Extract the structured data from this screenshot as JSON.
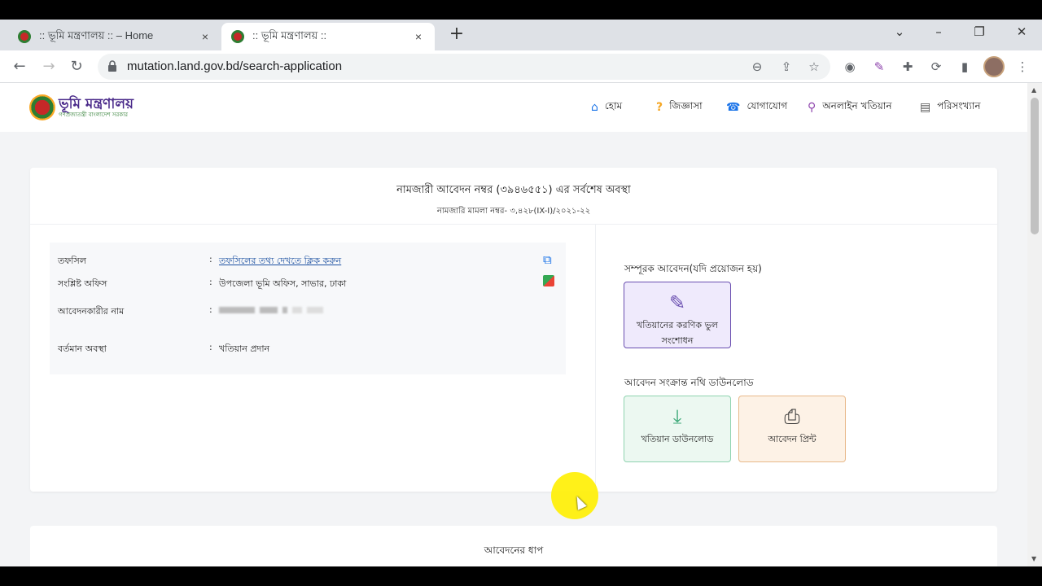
{
  "tabs": [
    {
      "title": ":: ভূমি মন্ত্রণালয় :: – Home",
      "close": "×"
    },
    {
      "title": ":: ভূমি মন্ত্রণালয় ::",
      "close": "×"
    }
  ],
  "new_tab": "+",
  "window_controls": {
    "dropdown": "⌄",
    "minimize": "–",
    "restore": "❐",
    "close": "✕"
  },
  "address_bar": {
    "url": "mutation.land.gov.bd/search-application"
  },
  "nav": {
    "back": "←",
    "forward": "→",
    "reload": "↻"
  },
  "site": {
    "logo_name": "ভূমি মন্ত্রণালয়",
    "logo_sub": "গণপ্রজাতন্ত্রী বাংলাদেশ সরকার",
    "menu": [
      {
        "icon": "⌂",
        "label": "হোম"
      },
      {
        "icon": "?",
        "label": "জিজ্ঞাসা"
      },
      {
        "icon": "☎",
        "label": "যোগাযোগ"
      },
      {
        "icon": "⚲",
        "label": "অনলাইন খতিয়ান"
      },
      {
        "icon": "▤",
        "label": "পরিসংখ্যান"
      }
    ]
  },
  "status_card": {
    "title": "নামজারী আবেদন নম্বর (৩৯৪৬৫৫১) এর সর্বশেষ অবস্থা",
    "case_no": "নামজারি মামলা নম্বর- ৩,৪২৮(IX-I)/২০২১-২২",
    "rows": [
      {
        "label": "তফসিল",
        "colon": ":",
        "value": "তফসিলের তথ্য দেখতে ক্লিক করুন"
      },
      {
        "label": "সংশ্লিষ্ট অফিস",
        "colon": ":",
        "value": "উপজেলা ভূমি অফিস, সাভার, ঢাকা"
      },
      {
        "label": "আবেদনকারীর নাম",
        "colon": ":",
        "value": ""
      },
      {
        "label": "বর্তমান অবস্থা",
        "colon": ":",
        "value": "খতিয়ান প্রদান"
      }
    ],
    "supplementary_title": "সম্পূরক আবেদন(যদি প্রয়োজন হয়)",
    "correction_button": "খতিয়ানের করণিক ভুল সংশোধন",
    "downloads_title": "আবেদন সংক্রান্ত নথি ডাউনলোড",
    "download_khatian": "খতিয়ান ডাউনলোড",
    "print_application": "আবেদন প্রিন্ট"
  },
  "steps_card": {
    "title": "আবেদনের ধাপ"
  }
}
